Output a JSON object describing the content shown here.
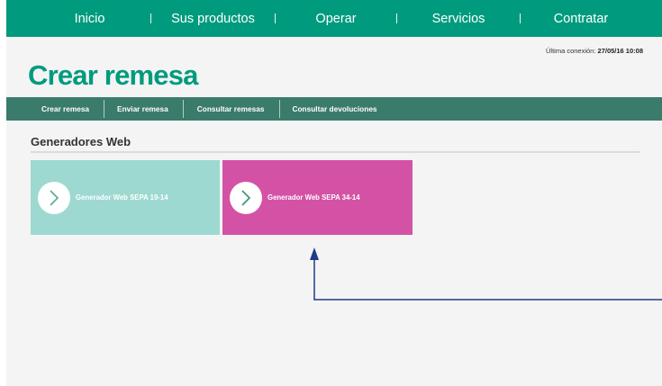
{
  "topnav": {
    "items": [
      {
        "label": "Inicio"
      },
      {
        "label": "Sus productos"
      },
      {
        "label": "Operar"
      },
      {
        "label": "Servicios"
      },
      {
        "label": "Contratar"
      }
    ]
  },
  "header": {
    "last_connection_label": "Última conexión:",
    "last_connection_value": "27/05/16 10:08",
    "title": "Crear remesa"
  },
  "subnav": {
    "items": [
      {
        "label": "Crear remesa"
      },
      {
        "label": "Enviar remesa"
      },
      {
        "label": "Consultar remesas"
      },
      {
        "label": "Consultar devoluciones"
      }
    ]
  },
  "section": {
    "title": "Generadores Web",
    "tiles": [
      {
        "label": "Generador Web SEPA 19-14",
        "color": "#9dd9d0",
        "icon": "chevron-right-icon"
      },
      {
        "label": "Generador Web SEPA 34-14",
        "color": "#d452a5",
        "icon": "chevron-right-icon"
      }
    ]
  },
  "colors": {
    "brand": "#009b7e",
    "subnav": "#3a7b6c",
    "annotation_arrow": "#1f3a8a"
  }
}
